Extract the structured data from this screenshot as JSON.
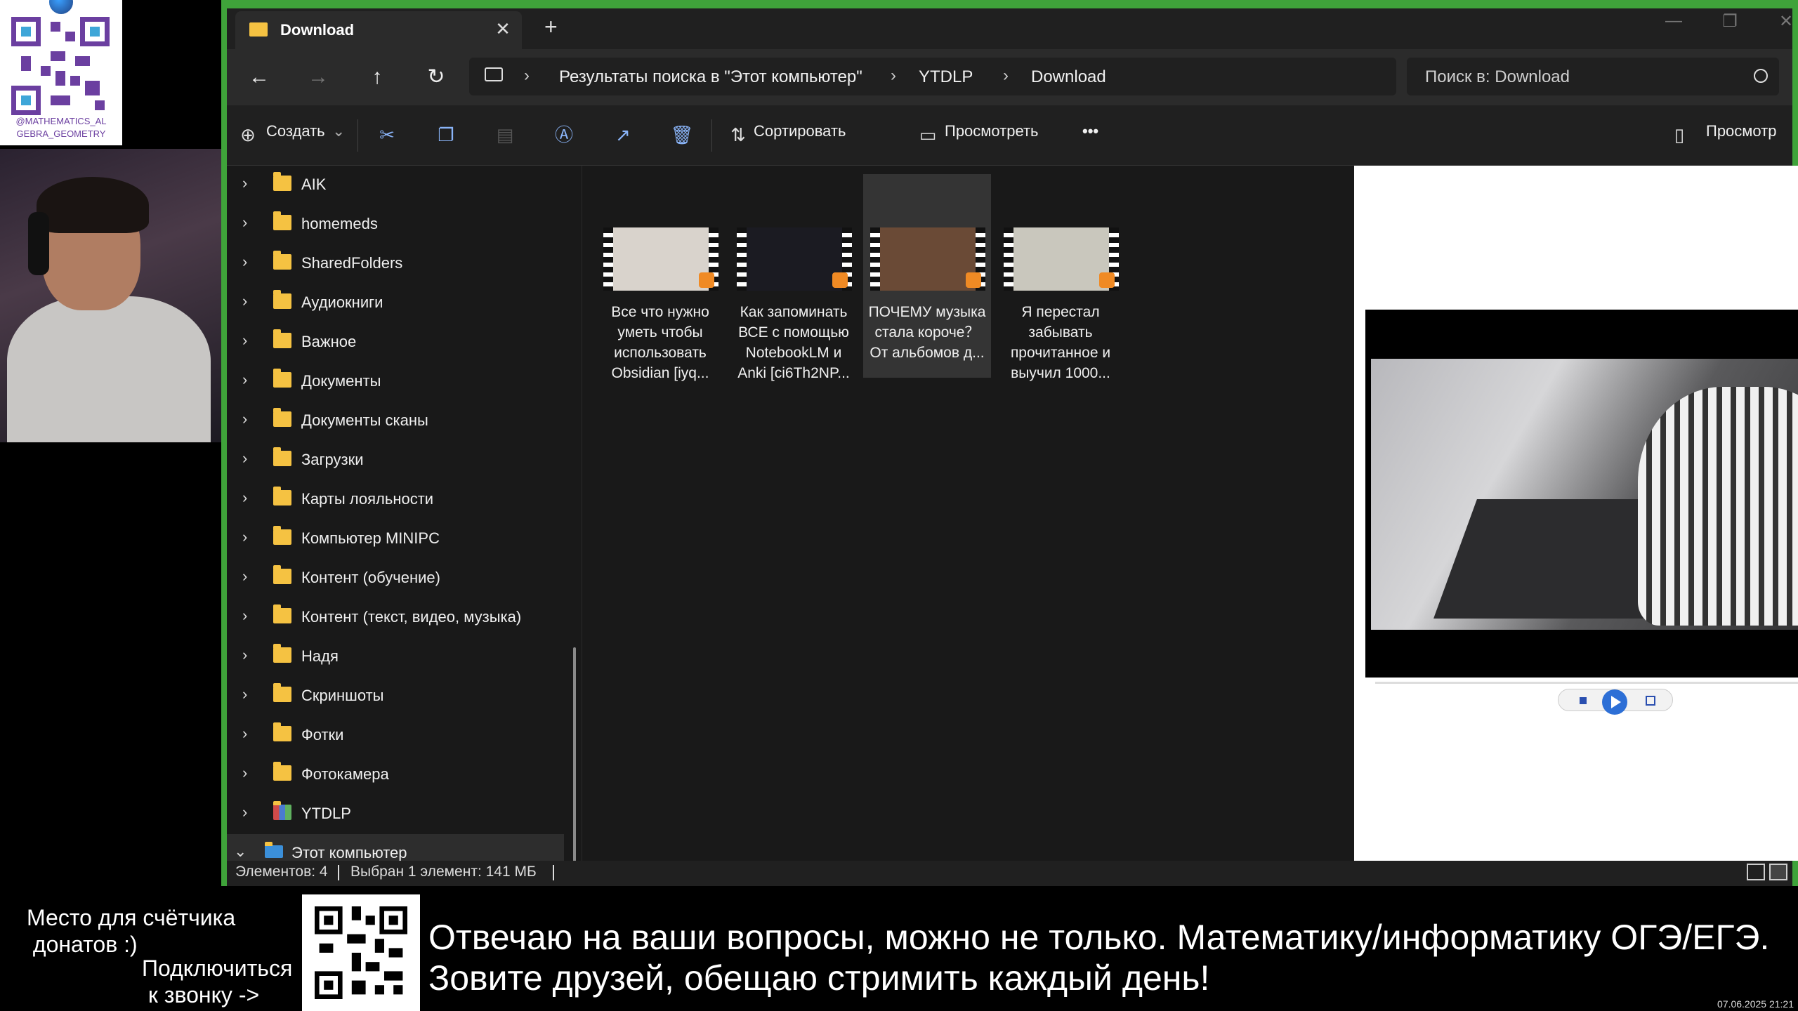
{
  "overlay": {
    "handle": "@MATHEMATICS_AL GEBRA_GEOMETRY",
    "donation_counter": "Место для счётчика\n донатов :)",
    "call_prompt": "Подключиться\n к звонку ->",
    "ticker_line1": "Отвечаю на ваши вопросы, можно не только. Математику/информатику ОГЭ/ЕГЭ.",
    "ticker_line2": "Зовите друзей, обещаю стримить каждый день!",
    "clock": "07.06.2025 21:21"
  },
  "window": {
    "tab_title": "Download",
    "tab_close": "✕",
    "new_tab": "+",
    "controls": {
      "minimize": "—",
      "maximize": "❐",
      "close": "✕"
    }
  },
  "navbar": {
    "back": "←",
    "forward": "→",
    "up": "↑",
    "refresh": "↻",
    "breadcrumb": [
      "Результаты поиска в \"Этот компьютер\"",
      "YTDLP",
      "Download"
    ],
    "separator": "›",
    "search_placeholder": "Поиск в: Download"
  },
  "toolbar": {
    "create": "Создать",
    "sort": "Сортировать",
    "view": "Просмотреть",
    "more": "•••",
    "preview": "Просмотр",
    "icons": [
      "cut-icon",
      "copy-icon",
      "paste-icon",
      "rename-icon",
      "share-icon",
      "delete-icon"
    ]
  },
  "nav_tree": [
    {
      "label": "AIK",
      "icon": "folder-icon"
    },
    {
      "label": "homemeds",
      "icon": "folder-icon"
    },
    {
      "label": "SharedFolders",
      "icon": "folder-icon"
    },
    {
      "label": "Аудиокниги",
      "icon": "folder-icon"
    },
    {
      "label": "Важное",
      "icon": "folder-icon"
    },
    {
      "label": "Документы",
      "icon": "folder-icon"
    },
    {
      "label": "Документы сканы",
      "icon": "folder-icon"
    },
    {
      "label": "Загрузки",
      "icon": "folder-icon"
    },
    {
      "label": "Карты лояльности",
      "icon": "folder-icon"
    },
    {
      "label": "Компьютер MINIPC",
      "icon": "folder-icon"
    },
    {
      "label": "Контент (обучение)",
      "icon": "folder-icon"
    },
    {
      "label": "Контент (текст, видео, музыка)",
      "icon": "folder-icon"
    },
    {
      "label": "Надя",
      "icon": "folder-icon"
    },
    {
      "label": "Скриншоты",
      "icon": "folder-icon"
    },
    {
      "label": "Фотки",
      "icon": "folder-icon"
    },
    {
      "label": "Фотокамера",
      "icon": "folder-icon"
    },
    {
      "label": "YTDLP",
      "icon": "archive-icon"
    },
    {
      "label": "Этот компьютер",
      "icon": "computer-icon",
      "expanded": true
    }
  ],
  "files": [
    {
      "name": "Все что нужно уметь чтобы использовать Obsidian [iyq...",
      "thumb_color": "#d9d3cc",
      "selected": false
    },
    {
      "name": "Как запоминать ВСЕ с помощью NotebookLM и Anki [ci6Th2NP...",
      "thumb_color": "#1b1b22",
      "selected": false
    },
    {
      "name": "ПОЧЕМУ музыка стала короче？ От альбомов д...",
      "thumb_color": "#6a4a36",
      "selected": true
    },
    {
      "name": "Я перестал забывать прочитанное и выучил 1000...",
      "thumb_color": "#c9c7bd",
      "selected": false
    }
  ],
  "status": {
    "count": "Элементов: 4",
    "selection": "Выбран 1 элемент: 141 МБ"
  },
  "colors": {
    "accent_border": "#3fa33a",
    "folder": "#f5c242",
    "play_badge": "#f08a24"
  }
}
